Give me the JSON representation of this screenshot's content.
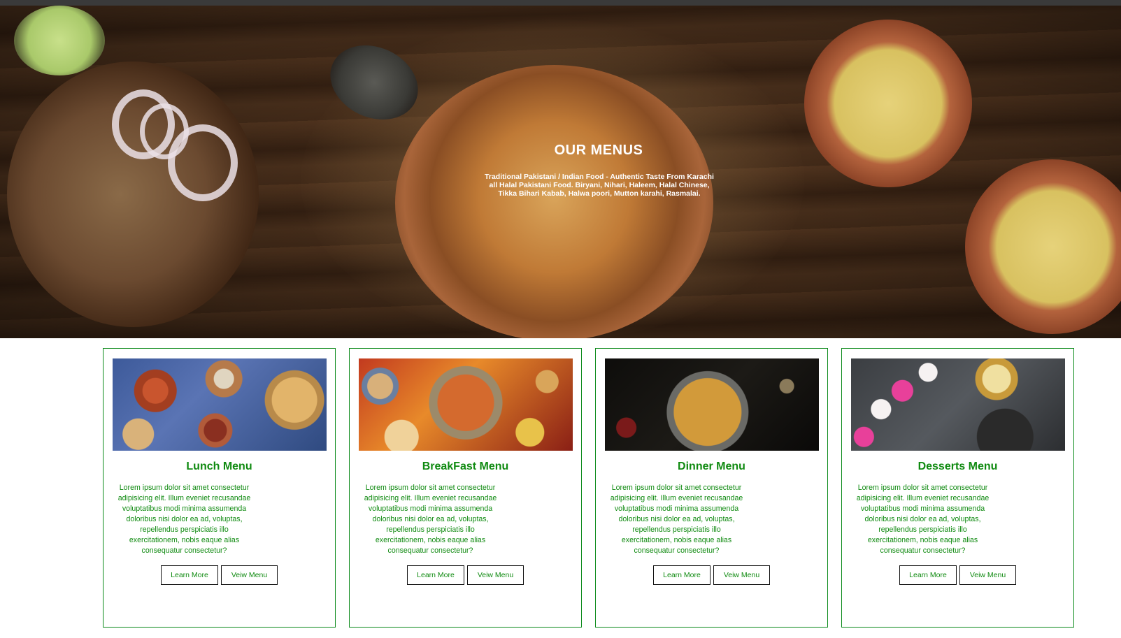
{
  "hero": {
    "title": "OUR MENUS",
    "description": "Traditional Pakistani / Indian Food - Authentic Taste From Karachi all Halal Pakistani Food. Biryani, Nihari, Haleem, Halal Chinese, Tikka Bihari Kabab, Halwa poori, Mutton karahi, Rasmalai."
  },
  "colors": {
    "accent_green": "#0f8a10",
    "card_border": "#0b8a1a",
    "button_border": "#111111"
  },
  "cards": [
    {
      "title": "Lunch Menu",
      "body": "Lorem ipsum dolor sit amet consectetur adipisicing elit. Illum eveniet recusandae voluptatibus modi minima assumenda doloribus nisi dolor ea ad, voluptas, repellendus perspiciatis illo exercitationem, nobis eaque alias consequatur consectetur?",
      "learn_label": "Learn More",
      "view_label": "Veiw Menu"
    },
    {
      "title": "BreakFast Menu",
      "body": "Lorem ipsum dolor sit amet consectetur adipisicing elit. Illum eveniet recusandae voluptatibus modi minima assumenda doloribus nisi dolor ea ad, voluptas, repellendus perspiciatis illo exercitationem, nobis eaque alias consequatur consectetur?",
      "learn_label": "Learn More",
      "view_label": "Veiw Menu"
    },
    {
      "title": "Dinner Menu",
      "body": "Lorem ipsum dolor sit amet consectetur adipisicing elit. Illum eveniet recusandae voluptatibus modi minima assumenda doloribus nisi dolor ea ad, voluptas, repellendus perspiciatis illo exercitationem, nobis eaque alias consequatur consectetur?",
      "learn_label": "Learn More",
      "view_label": "Veiw Menu"
    },
    {
      "title": "Desserts Menu",
      "body": "Lorem ipsum dolor sit amet consectetur adipisicing elit. Illum eveniet recusandae voluptatibus modi minima assumenda doloribus nisi dolor ea ad, voluptas, repellendus perspiciatis illo exercitationem, nobis eaque alias consequatur consectetur?",
      "learn_label": "Learn More",
      "view_label": "Veiw Menu"
    }
  ]
}
